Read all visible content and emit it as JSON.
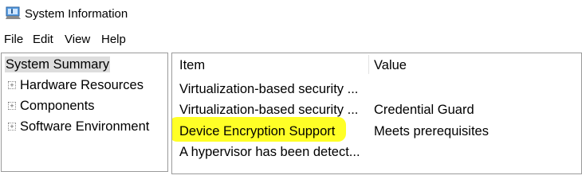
{
  "window": {
    "title": "System Information",
    "icon": "system-information-icon"
  },
  "menu": {
    "items": [
      {
        "label": "File"
      },
      {
        "label": "Edit"
      },
      {
        "label": "View"
      },
      {
        "label": "Help"
      }
    ]
  },
  "tree": {
    "root_label": "System Summary",
    "children": [
      {
        "label": "Hardware Resources",
        "expander": "+"
      },
      {
        "label": "Components",
        "expander": "+"
      },
      {
        "label": "Software Environment",
        "expander": "+"
      }
    ]
  },
  "table": {
    "columns": [
      "Item",
      "Value"
    ],
    "rows": [
      {
        "item": "Virtualization-based security ...",
        "value": ""
      },
      {
        "item": "Virtualization-based security ...",
        "value": "Credential Guard"
      },
      {
        "item": "Device Encryption Support",
        "value": "Meets prerequisites"
      },
      {
        "item": "A hypervisor has been detect...",
        "value": ""
      }
    ]
  },
  "colors": {
    "highlight": "#ffff00",
    "selection": "#dddddd",
    "border": "#9a9a9a"
  }
}
